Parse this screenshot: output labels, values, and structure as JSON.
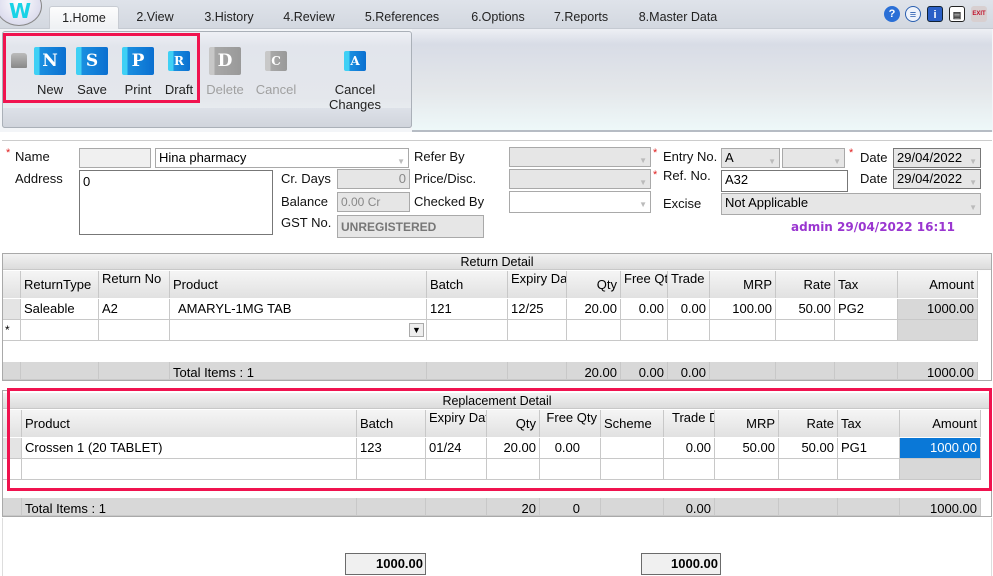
{
  "app": {
    "logo_glyph": "W"
  },
  "tabs": [
    {
      "label": "1.Home",
      "active": true
    },
    {
      "label": "2.View"
    },
    {
      "label": "3.History"
    },
    {
      "label": "4.Review"
    },
    {
      "label": "5.References"
    },
    {
      "label": "6.Options"
    },
    {
      "label": "7.Reports"
    },
    {
      "label": "8.Master Data"
    }
  ],
  "top_icons": [
    {
      "name": "help-icon",
      "glyph": "?"
    },
    {
      "name": "chat-icon",
      "glyph": "≡"
    },
    {
      "name": "info-icon",
      "glyph": "i"
    },
    {
      "name": "document-icon",
      "glyph": "▤"
    },
    {
      "name": "exit-icon",
      "glyph": "EXIT"
    }
  ],
  "toolbar": {
    "buttons": [
      {
        "label": "New",
        "glyph": "N",
        "enabled": true
      },
      {
        "label": "Save",
        "glyph": "S",
        "enabled": true
      },
      {
        "label": "Print",
        "glyph": "P",
        "enabled": true
      },
      {
        "label": "Draft",
        "glyph": "R",
        "enabled": true
      },
      {
        "label": "Delete",
        "glyph": "D",
        "enabled": false
      },
      {
        "label": "Cancel",
        "glyph": "C",
        "enabled": false
      },
      {
        "label": "Cancel Changes",
        "glyph": "A",
        "enabled": true
      }
    ]
  },
  "form": {
    "name_label": "Name",
    "name_code": "",
    "name_value": "Hina pharmacy",
    "address_label": "Address",
    "address_value": "0",
    "cr_days_label": "Cr. Days",
    "cr_days_value": "0",
    "balance_label": "Balance",
    "balance_value": "0.00 Cr",
    "gst_label": "GST No.",
    "gst_value": "UNREGISTERED",
    "refer_by_label": "Refer By",
    "refer_by_value": "",
    "price_disc_label": "Price/Disc.",
    "price_disc_value": "",
    "checked_by_label": "Checked By",
    "checked_by_value": "",
    "entry_no_label": "Entry No.",
    "entry_no_series": "A",
    "entry_no_value": "",
    "ref_no_label": "Ref. No.",
    "ref_no_value": "A32",
    "excise_label": "Excise",
    "excise_value": "Not Applicable",
    "date_label": "Date",
    "date_value": "29/04/2022",
    "date2_label": "Date",
    "date2_value": "29/04/2022",
    "audit_text": "admin 29/04/2022 16:11",
    "required_marker": "*"
  },
  "return_detail": {
    "title": "Return Detail",
    "columns": [
      "ReturnType",
      "Return No",
      "Product",
      "Batch",
      "Expiry Date",
      "Qty",
      "Free Qty",
      "Trade Disc",
      "MRP",
      "Rate",
      "Tax",
      "Amount"
    ],
    "rows": [
      [
        "Saleable",
        "A2",
        "AMARYL-1MG TAB",
        "121",
        "12/25",
        "20.00",
        "0.00",
        "0.00",
        "100.00",
        "50.00",
        "PG2",
        "1000.00"
      ]
    ],
    "new_row_marker": "*",
    "totals": {
      "label": "Total Items : 1",
      "qty": "20.00",
      "free_qty": "0.00",
      "trade_disc": "0.00",
      "amount": "1000.00"
    }
  },
  "replacement_detail": {
    "title": "Replacement Detail",
    "columns": [
      "Product",
      "Batch",
      "Expiry Date",
      "Qty",
      "Free Qty",
      "Scheme",
      "Trade Disc",
      "MRP",
      "Rate",
      "Tax",
      "Amount"
    ],
    "rows": [
      [
        "Crossen 1 (20 TABLET)",
        "123",
        "01/24",
        "20.00",
        "0.00",
        "",
        "0.00",
        "50.00",
        "50.00",
        "PG1",
        "1000.00"
      ]
    ],
    "totals": {
      "label": "Total Items : 1",
      "qty": "20",
      "free_qty": "0",
      "trade_disc": "0.00",
      "amount": "1000.00"
    }
  },
  "footer": {
    "return_total": "1000.00",
    "replacement_total": "1000.00"
  }
}
